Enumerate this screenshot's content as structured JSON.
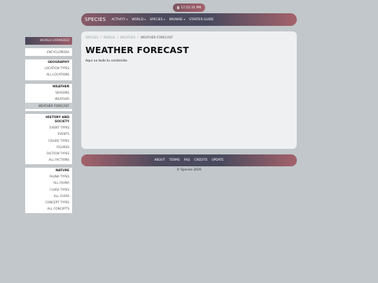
{
  "clock": {
    "time": "17:22:31 PM"
  },
  "navbar": {
    "brand": "SPECIES",
    "items": [
      {
        "label": "ACTIVITY",
        "has_caret": true
      },
      {
        "label": "WORLD",
        "has_caret": true
      },
      {
        "label": "SPECIES",
        "has_caret": true
      },
      {
        "label": "BROWSE",
        "has_caret": true
      },
      {
        "label": "STARTER GUIDE",
        "has_caret": false
      }
    ]
  },
  "sidebar": {
    "header": "WORLD EXPANDED",
    "encyclopedia": "ENCYCLOPEDIA",
    "geography": {
      "title": "GEOGRAPHY",
      "items": [
        "LOCATION TYPES",
        "ALL LOCATIONS"
      ]
    },
    "weather": {
      "title": "WEATHER",
      "items": [
        "SEASONS",
        "WEATHER",
        "WEATHER FORECAST"
      ]
    },
    "history": {
      "title_line1": "HISTORY AND",
      "title_line2": "SOCIETY",
      "items": [
        "EVENT TYPES",
        "EVENTS",
        "FIGURE TYPES",
        "FIGURES",
        "FACTION TYPES",
        "ALL FACTIONS"
      ]
    },
    "nature": {
      "title": "NATURE",
      "items": [
        "FAUNA TYPES",
        "ALL FAUNA",
        "FLORA TYPES",
        "ALL FLORA",
        "CONCEPT TYPES",
        "ALL CONCEPTS"
      ]
    }
  },
  "breadcrumb": {
    "items": [
      "SPECIES",
      "WORLD",
      "WEATHER"
    ],
    "current": "WEATHER FORECAST",
    "separator": "/"
  },
  "page": {
    "title": "WEATHER FORECAST",
    "content": "Aquí va todo tu contenido."
  },
  "footer": {
    "links": [
      "ABOUT",
      "TERMS",
      "FAQ",
      "CREDITS",
      "UPDATE"
    ],
    "copyright": "© Species 2026"
  }
}
